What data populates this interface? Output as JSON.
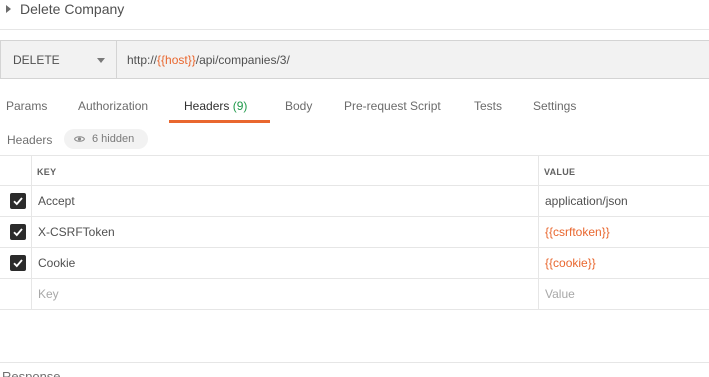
{
  "request": {
    "title": "Delete Company",
    "method": "DELETE",
    "url_prefix": "http://",
    "url_variable": "{{host}}",
    "url_suffix": "/api/companies/3/"
  },
  "tabs": [
    {
      "label": "Params"
    },
    {
      "label": "Authorization"
    },
    {
      "label": "Headers",
      "count": "(9)",
      "active": true
    },
    {
      "label": "Body"
    },
    {
      "label": "Pre-request Script"
    },
    {
      "label": "Tests"
    },
    {
      "label": "Settings"
    }
  ],
  "headers_section": {
    "label": "Headers",
    "hidden_label": "6 hidden"
  },
  "table": {
    "columns": {
      "key": "KEY",
      "value": "VALUE"
    },
    "rows": [
      {
        "key": "Accept",
        "value": "application/json",
        "checked": true
      },
      {
        "key": "X-CSRFToken",
        "value": "{{csrftoken}}",
        "checked": true
      },
      {
        "key": "Cookie",
        "value": "{{cookie}}",
        "checked": true
      }
    ],
    "placeholder": {
      "key": "Key",
      "value": "Value"
    }
  },
  "response": {
    "label": "Response"
  },
  "colors": {
    "accent": "#e9672f",
    "count_green": "#1f9a4a",
    "checkbox": "#2b2b2b"
  }
}
